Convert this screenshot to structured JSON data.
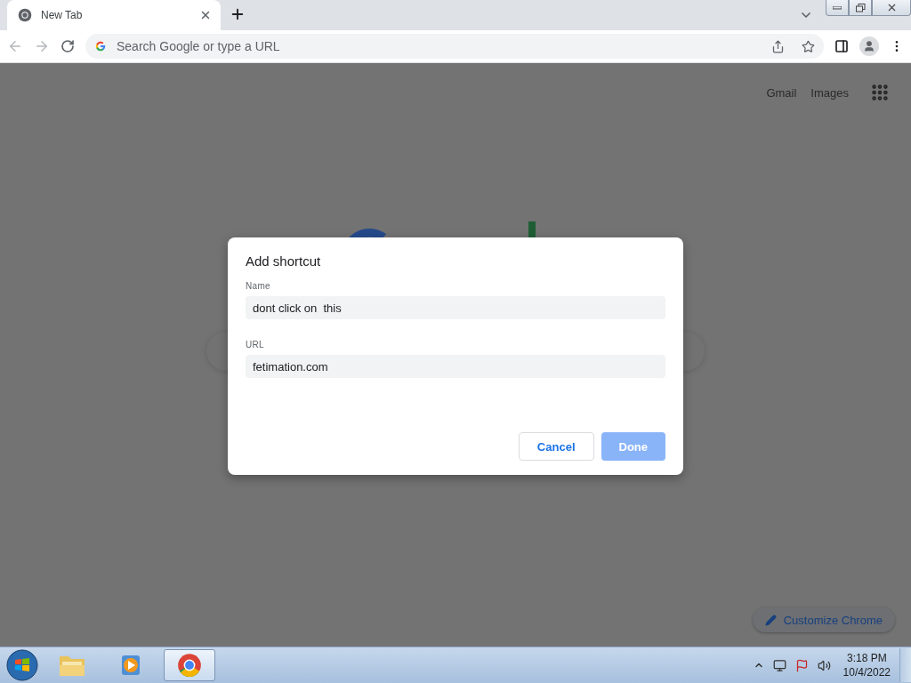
{
  "tabs": [
    {
      "title": "New Tab",
      "selected": true
    }
  ],
  "address_bar": {
    "placeholder": "Search Google or type a URL"
  },
  "page": {
    "links": [
      "Gmail",
      "Images"
    ],
    "customize_button": "Customize Chrome"
  },
  "dialog": {
    "title": "Add shortcut",
    "fields": [
      {
        "label": "Name",
        "value": "dont click on  this"
      },
      {
        "label": "URL",
        "value": "fetimation.com"
      }
    ],
    "buttons": [
      {
        "label": "Cancel",
        "kind": "secondary"
      },
      {
        "label": "Done",
        "kind": "primary"
      }
    ]
  },
  "taskbar": {
    "apps": [
      {
        "kind": "folder",
        "selected": false
      },
      {
        "kind": "media",
        "selected": false
      },
      {
        "kind": "chrome",
        "selected": true
      }
    ],
    "time": "3:18 PM",
    "date": "10/4/2022"
  }
}
